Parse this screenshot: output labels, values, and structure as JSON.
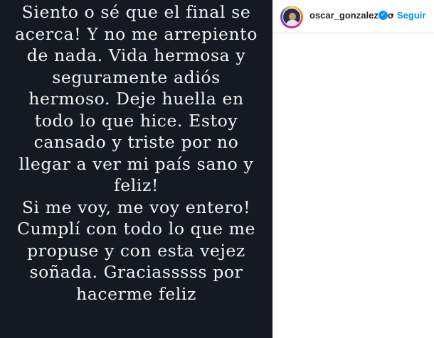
{
  "post": {
    "lines": [
      "Siento o sé que el final se",
      "acerca! Y no me arrepiento",
      "de nada. Vida hermosa y",
      "seguramente adiós",
      "hermoso. Deje huella en",
      "todo lo que hice. Estoy",
      "cansado y triste por no",
      "llegar a ver mi país sano y",
      "feliz!",
      "Si me voy, me voy entero!",
      "Cumplí con todo lo que me",
      "propuse y con esta vejez",
      "soñada. Graciasssss por",
      "hacerme feliz"
    ]
  },
  "header": {
    "username": "oscar_gonzalezoro",
    "verified_glyph": "✓",
    "separator": "•",
    "follow_label": "Seguir"
  },
  "colors": {
    "post_background": "#151a22",
    "text": "#f2f2f2",
    "accent": "#0095f6"
  },
  "icons": {
    "verified": "verified-badge-icon",
    "avatar": "profile-avatar"
  }
}
